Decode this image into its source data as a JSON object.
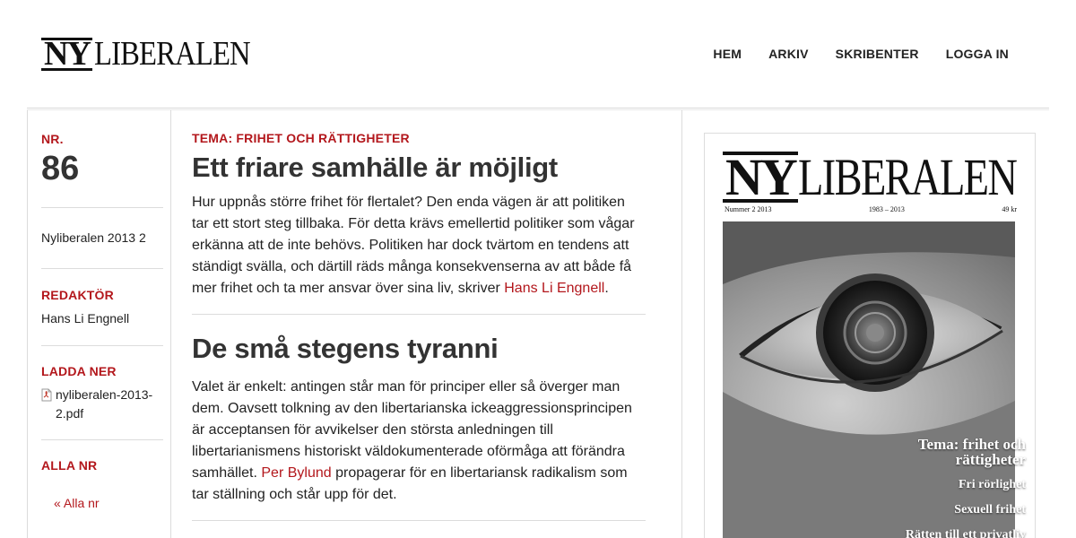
{
  "header": {
    "logo_ny": "NY",
    "logo_rest": "LIBERALEN",
    "nav": [
      "HEM",
      "ARKIV",
      "SKRIBENTER",
      "LOGGA IN"
    ]
  },
  "sidebar": {
    "nr_label": "NR.",
    "nr_value": "86",
    "issue_name": "Nyliberalen 2013 2",
    "editor_label": "REDAKTÖR",
    "editor_name": "Hans Li Engnell",
    "download_label": "LADDA NER",
    "download_file": "nyliberalen-2013-2.pdf",
    "all_label": "ALLA NR",
    "all_link": "« Alla nr"
  },
  "articles": [
    {
      "kicker": "TEMA: FRIHET OCH RÄTTIGHETER",
      "title": "Ett friare samhälle är möjligt",
      "text": "Hur uppnås större frihet för flertalet? Den enda vägen är att politiken tar ett stort steg tillbaka. För detta krävs emellertid politiker som vågar erkänna att de inte behövs. Politiken har dock tvärtom en tendens att ständigt svälla, och därtill räds många konsekvenserna av att både få mer frihet och ta mer ansvar över sina liv, skriver ",
      "author": "Hans Li Engnell",
      "after": "."
    },
    {
      "title": "De små stegens tyranni",
      "text": "Valet är enkelt: antingen står man för principer eller så överger man dem. Oavsett tolkning av den libertarianska ickeaggressionsprincipen är acceptansen för avvikelser den största anledningen till libertarianismens historiskt väldokumenterade oförmåga att förändra samhället. ",
      "author": "Per Bylund",
      "after": " propagerar för en libertariansk radikalism som tar ställning och står upp för det."
    }
  ],
  "cover": {
    "masthead_ny": "NY",
    "masthead_rest": "LIBERALEN",
    "issue": "Nummer 2 2013",
    "years": "1983 – 2013",
    "price": "49 kr",
    "theme_line1": "Tema: frihet och",
    "theme_line2": "rättigheter",
    "lines": [
      "Fri rörlighet",
      "Sexuell frihet",
      "Rätten till ett privatliv"
    ]
  },
  "colors": {
    "accent": "#b3171c",
    "text": "#222222",
    "rule": "#dcdcdc"
  }
}
